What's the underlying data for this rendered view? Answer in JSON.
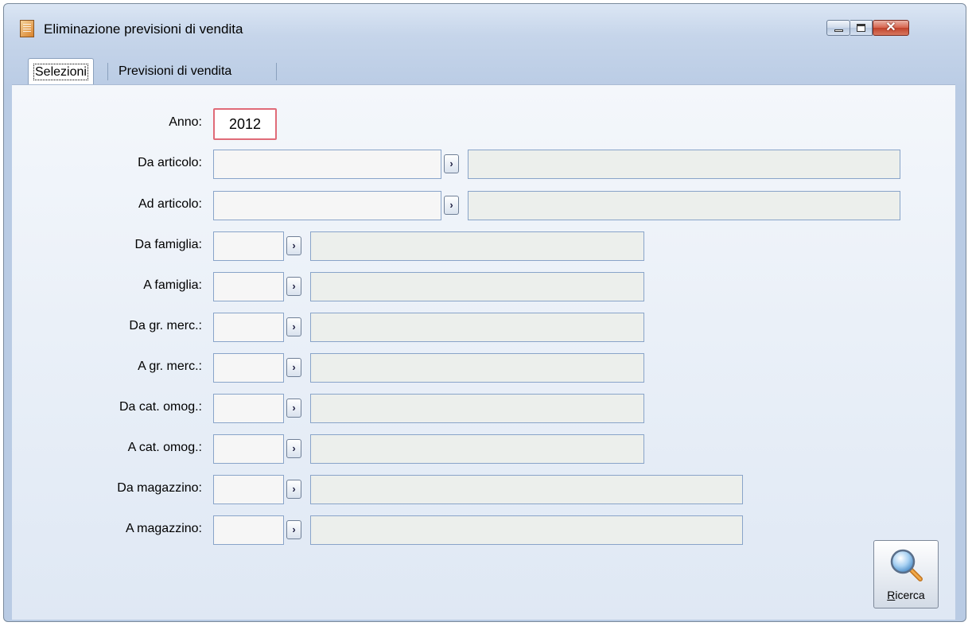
{
  "window": {
    "title": "Eliminazione previsioni di vendita",
    "controls": {
      "minimize": "minimize-icon",
      "maximize": "maximize-icon",
      "close": "close-icon"
    }
  },
  "tabs": [
    {
      "label": "Selezioni",
      "selected": true
    },
    {
      "label": "Previsioni di vendita",
      "selected": false
    }
  ],
  "form": {
    "anno": {
      "label": "Anno:",
      "value": "2012"
    },
    "da_articolo": {
      "label": "Da articolo:",
      "value": "",
      "description": ""
    },
    "ad_articolo": {
      "label": "Ad articolo:",
      "value": "",
      "description": ""
    },
    "da_famiglia": {
      "label": "Da famiglia:",
      "value": "",
      "description": ""
    },
    "a_famiglia": {
      "label": "A famiglia:",
      "value": "",
      "description": ""
    },
    "da_gr_merc": {
      "label": "Da gr. merc.:",
      "value": "",
      "description": ""
    },
    "a_gr_merc": {
      "label": "A gr. merc.:",
      "value": "",
      "description": ""
    },
    "da_cat_omog": {
      "label": "Da cat. omog.:",
      "value": "",
      "description": ""
    },
    "a_cat_omog": {
      "label": "A cat. omog.:",
      "value": "",
      "description": ""
    },
    "da_magazzino": {
      "label": "Da magazzino:",
      "value": "",
      "description": ""
    },
    "a_magazzino": {
      "label": "A magazzino:",
      "value": "",
      "description": ""
    },
    "zoom_button_glyph": "›"
  },
  "actions": {
    "ricerca": {
      "label": "Ricerca",
      "icon": "magnifier-icon"
    }
  },
  "colors": {
    "window_frame": "#7a8a9c",
    "field_border": "#89a4c9",
    "required_field_border": "#e06b78",
    "close_button": "#c0412a"
  }
}
